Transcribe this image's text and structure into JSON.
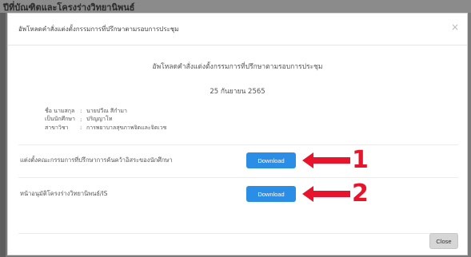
{
  "background": {
    "partial_title": "ปีที่บัณฑิตและโครงร่างวิทยานิพนธ์"
  },
  "modal": {
    "header_title": "อัพโหลดคำสั่งแต่งตั้งกรรมการที่ปรึกษาตามรอบการประชุม",
    "close_symbol": "×",
    "center_title": "อัพโหลดคำสั่งแต่งตั้งกรรมการที่ปรึกษาตามรอบการประชุม",
    "date": "25 กันยายน 2565",
    "info": [
      {
        "label": "ชื่อ นามสกุล",
        "sep": ":",
        "value": "นายปวีณ สีกำมา"
      },
      {
        "label": "เป็นนักศึกษา",
        "sep": ":",
        "value": "ปริญญาโท"
      },
      {
        "label": "สาขาวิชา",
        "sep": ":",
        "value": "การพยาบาลสุขภาพจิตและจิตเวช"
      }
    ],
    "rows": [
      {
        "label": "แต่งตั้งคณะกรรมการที่ปรึกษาการค้นคว้าอิสระของนักศึกษา",
        "button": "Download",
        "annotation": "1"
      },
      {
        "label": "หน้าอนุมัติโครงร่างวิทยานิพนธ์/IS",
        "button": "Download",
        "annotation": "2"
      }
    ],
    "close_button": "Close"
  },
  "colors": {
    "primary_button": "#2a8ee6",
    "annotation_red": "#e8142c"
  }
}
